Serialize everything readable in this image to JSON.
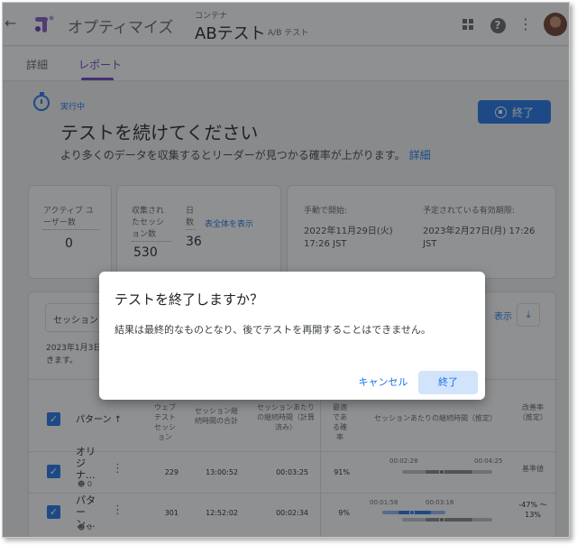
{
  "header": {
    "app_title": "オプティマイズ",
    "container_label": "コンテナ",
    "experiment_name": "ABテスト",
    "experiment_type": "A/B テスト",
    "back_icon": "arrow-left-icon",
    "apps_icon": "apps-grid-icon",
    "help_icon": "help-icon",
    "more_icon": "more-vert-icon"
  },
  "tabs": [
    {
      "label": "詳細",
      "active": false
    },
    {
      "label": "レポート",
      "active": true
    }
  ],
  "status": {
    "label": "実行中",
    "headline": "テストを続けてください",
    "description": "より多くのデータを収集するとリーダーが見つかる確率が上がります。",
    "details_link": "詳細",
    "end_button": "終了"
  },
  "stats": {
    "active_users_label": "アクティブ ユーザー数",
    "active_users_value": "0",
    "sessions_label": "収集されたセッション数",
    "sessions_value": "530",
    "days_label": "日数",
    "days_value": "36",
    "show_all_link": "表全体を表示",
    "started_label": "手動で開始:",
    "started_value": "2022年11月29日(火) 17:26 JST",
    "expiry_label": "予定されている有効期限:",
    "expiry_value": "2023年2月27日(月) 17:26 JST"
  },
  "report": {
    "session_select": "セッション",
    "show_button": "表示",
    "download_icon": "download-icon",
    "date_note": "2023年1月3日 きます。",
    "columns": {
      "pattern": "パターン",
      "web_sessions": "ウェブテストセッション",
      "session_duration_total": "セッション継続時間の合計",
      "avg_duration_calc": "セッションあたりの継続時間（計算済み）",
      "best_probability": "最適である確率",
      "avg_duration_est": "セッションあたりの継続時間（推定）",
      "improvement": "改善率（推定）"
    },
    "rows": [
      {
        "pattern": "オリジナ...",
        "users": "0",
        "web_sessions": "229",
        "duration_total": "13:00:52",
        "avg_duration": "00:03:25",
        "best_probability": "91%",
        "range_low": "00:02:28",
        "range_high": "00:04:25",
        "improvement": "基準値"
      },
      {
        "pattern": "パターン...",
        "users": "0",
        "web_sessions": "301",
        "duration_total": "12:52:02",
        "avg_duration": "00:02:34",
        "best_probability": "9%",
        "range_low": "00:01:58",
        "range_high": "00:03:16",
        "improvement": "-47% 〜 13%"
      }
    ]
  },
  "dialog": {
    "title": "テストを終了しますか？",
    "body": "結果は最終的なものとなり、後でテストを再開することはできません。",
    "cancel": "キャンセル",
    "confirm": "終了"
  },
  "colors": {
    "primary": "#1a73e8",
    "accent": "#6c3fc2"
  }
}
